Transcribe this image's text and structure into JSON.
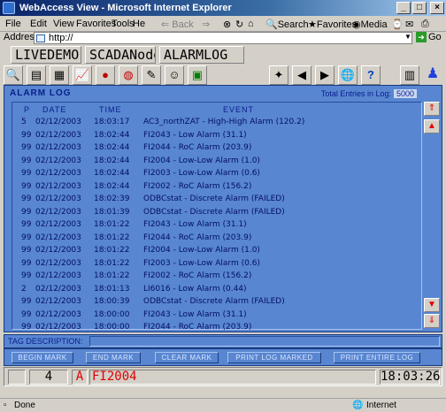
{
  "window": {
    "title": "WebAccess View - Microsoft Internet Explorer"
  },
  "menu": [
    "File",
    "Edit",
    "View",
    "Favorites",
    "Tools",
    "Help"
  ],
  "ie_toolbar": {
    "back": "Back",
    "search": "Search",
    "favorites": "Favorites",
    "media": "Media"
  },
  "address": {
    "label": "Address",
    "value": "http://",
    "go": "Go"
  },
  "tabs": [
    "LIVEDEMO",
    "SCADANode",
    "ALARMLOG"
  ],
  "panel": {
    "title": "ALARM LOG",
    "total_label": "Total Entries in Log:",
    "total_value": "5000",
    "columns": {
      "p": "P",
      "date": "DATE",
      "time": "TIME",
      "event": "EVENT"
    }
  },
  "log_rows": [
    {
      "p": "5",
      "date": "02/12/2003",
      "time": "18:03:17",
      "event": "AC3_northZAT - High-High Alarm (120.2)"
    },
    {
      "p": "99",
      "date": "02/12/2003",
      "time": "18:02:44",
      "event": "FI2043 - Low Alarm (31.1)"
    },
    {
      "p": "99",
      "date": "02/12/2003",
      "time": "18:02:44",
      "event": "FI2044 - RoC Alarm (203.9)"
    },
    {
      "p": "99",
      "date": "02/12/2003",
      "time": "18:02:44",
      "event": "FI2004 - Low-Low Alarm (1.0)"
    },
    {
      "p": "99",
      "date": "02/12/2003",
      "time": "18:02:44",
      "event": "FI2003 - Low-Low Alarm (0.6)"
    },
    {
      "p": "99",
      "date": "02/12/2003",
      "time": "18:02:44",
      "event": "FI2002 - RoC Alarm (156.2)"
    },
    {
      "p": "99",
      "date": "02/12/2003",
      "time": "18:02:39",
      "event": "ODBCstat - Discrete Alarm (FAILED)"
    },
    {
      "p": "99",
      "date": "02/12/2003",
      "time": "18:01:39",
      "event": "ODBCstat - Discrete Alarm (FAILED)"
    },
    {
      "p": "99",
      "date": "02/12/2003",
      "time": "18:01:22",
      "event": "FI2043 - Low Alarm (31.1)"
    },
    {
      "p": "99",
      "date": "02/12/2003",
      "time": "18:01:22",
      "event": "FI2044 - RoC Alarm (203.9)"
    },
    {
      "p": "99",
      "date": "02/12/2003",
      "time": "18:01:22",
      "event": "FI2004 - Low-Low Alarm (1.0)"
    },
    {
      "p": "99",
      "date": "02/12/2003",
      "time": "18:01:22",
      "event": "FI2003 - Low-Low Alarm (0.6)"
    },
    {
      "p": "99",
      "date": "02/12/2003",
      "time": "18:01:22",
      "event": "FI2002 - RoC Alarm (156.2)"
    },
    {
      "p": "2",
      "date": "02/12/2003",
      "time": "18:01:13",
      "event": "LI6016 - Low Alarm (0.44)"
    },
    {
      "p": "99",
      "date": "02/12/2003",
      "time": "18:00:39",
      "event": "ODBCstat - Discrete Alarm (FAILED)"
    },
    {
      "p": "99",
      "date": "02/12/2003",
      "time": "18:00:00",
      "event": "FI2043 - Low Alarm (31.1)"
    },
    {
      "p": "99",
      "date": "02/12/2003",
      "time": "18:00:00",
      "event": "FI2044 - RoC Alarm (203.9)"
    }
  ],
  "tag_description": {
    "label": "TAG DESCRIPTION:",
    "value": ""
  },
  "buttons": [
    "BEGIN MARK",
    "END MARK",
    "CLEAR MARK",
    "PRINT LOG MARKED",
    "PRINT ENTIRE LOG"
  ],
  "alarm_bar": {
    "count": "4",
    "flag": "A",
    "tag": "FI2004",
    "clock": "18:03:26"
  },
  "status": {
    "left": "Done",
    "zone": "Internet"
  },
  "colors": {
    "panel": "#5886d1",
    "text": "#0a1e8c",
    "alarm_red": "#e00000"
  }
}
